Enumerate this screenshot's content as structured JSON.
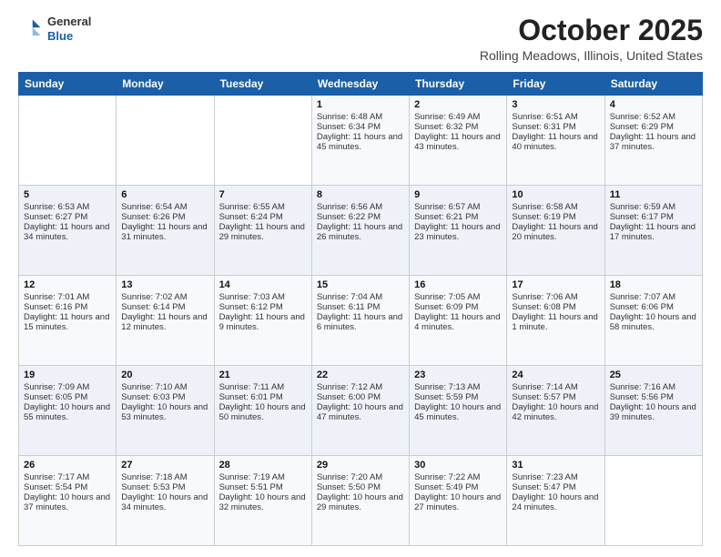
{
  "header": {
    "logo_general": "General",
    "logo_blue": "Blue",
    "month_title": "October 2025",
    "location": "Rolling Meadows, Illinois, United States"
  },
  "days_of_week": [
    "Sunday",
    "Monday",
    "Tuesday",
    "Wednesday",
    "Thursday",
    "Friday",
    "Saturday"
  ],
  "weeks": [
    [
      {
        "day": "",
        "sunrise": "",
        "sunset": "",
        "daylight": ""
      },
      {
        "day": "",
        "sunrise": "",
        "sunset": "",
        "daylight": ""
      },
      {
        "day": "",
        "sunrise": "",
        "sunset": "",
        "daylight": ""
      },
      {
        "day": "1",
        "sunrise": "Sunrise: 6:48 AM",
        "sunset": "Sunset: 6:34 PM",
        "daylight": "Daylight: 11 hours and 45 minutes."
      },
      {
        "day": "2",
        "sunrise": "Sunrise: 6:49 AM",
        "sunset": "Sunset: 6:32 PM",
        "daylight": "Daylight: 11 hours and 43 minutes."
      },
      {
        "day": "3",
        "sunrise": "Sunrise: 6:51 AM",
        "sunset": "Sunset: 6:31 PM",
        "daylight": "Daylight: 11 hours and 40 minutes."
      },
      {
        "day": "4",
        "sunrise": "Sunrise: 6:52 AM",
        "sunset": "Sunset: 6:29 PM",
        "daylight": "Daylight: 11 hours and 37 minutes."
      }
    ],
    [
      {
        "day": "5",
        "sunrise": "Sunrise: 6:53 AM",
        "sunset": "Sunset: 6:27 PM",
        "daylight": "Daylight: 11 hours and 34 minutes."
      },
      {
        "day": "6",
        "sunrise": "Sunrise: 6:54 AM",
        "sunset": "Sunset: 6:26 PM",
        "daylight": "Daylight: 11 hours and 31 minutes."
      },
      {
        "day": "7",
        "sunrise": "Sunrise: 6:55 AM",
        "sunset": "Sunset: 6:24 PM",
        "daylight": "Daylight: 11 hours and 29 minutes."
      },
      {
        "day": "8",
        "sunrise": "Sunrise: 6:56 AM",
        "sunset": "Sunset: 6:22 PM",
        "daylight": "Daylight: 11 hours and 26 minutes."
      },
      {
        "day": "9",
        "sunrise": "Sunrise: 6:57 AM",
        "sunset": "Sunset: 6:21 PM",
        "daylight": "Daylight: 11 hours and 23 minutes."
      },
      {
        "day": "10",
        "sunrise": "Sunrise: 6:58 AM",
        "sunset": "Sunset: 6:19 PM",
        "daylight": "Daylight: 11 hours and 20 minutes."
      },
      {
        "day": "11",
        "sunrise": "Sunrise: 6:59 AM",
        "sunset": "Sunset: 6:17 PM",
        "daylight": "Daylight: 11 hours and 17 minutes."
      }
    ],
    [
      {
        "day": "12",
        "sunrise": "Sunrise: 7:01 AM",
        "sunset": "Sunset: 6:16 PM",
        "daylight": "Daylight: 11 hours and 15 minutes."
      },
      {
        "day": "13",
        "sunrise": "Sunrise: 7:02 AM",
        "sunset": "Sunset: 6:14 PM",
        "daylight": "Daylight: 11 hours and 12 minutes."
      },
      {
        "day": "14",
        "sunrise": "Sunrise: 7:03 AM",
        "sunset": "Sunset: 6:12 PM",
        "daylight": "Daylight: 11 hours and 9 minutes."
      },
      {
        "day": "15",
        "sunrise": "Sunrise: 7:04 AM",
        "sunset": "Sunset: 6:11 PM",
        "daylight": "Daylight: 11 hours and 6 minutes."
      },
      {
        "day": "16",
        "sunrise": "Sunrise: 7:05 AM",
        "sunset": "Sunset: 6:09 PM",
        "daylight": "Daylight: 11 hours and 4 minutes."
      },
      {
        "day": "17",
        "sunrise": "Sunrise: 7:06 AM",
        "sunset": "Sunset: 6:08 PM",
        "daylight": "Daylight: 11 hours and 1 minute."
      },
      {
        "day": "18",
        "sunrise": "Sunrise: 7:07 AM",
        "sunset": "Sunset: 6:06 PM",
        "daylight": "Daylight: 10 hours and 58 minutes."
      }
    ],
    [
      {
        "day": "19",
        "sunrise": "Sunrise: 7:09 AM",
        "sunset": "Sunset: 6:05 PM",
        "daylight": "Daylight: 10 hours and 55 minutes."
      },
      {
        "day": "20",
        "sunrise": "Sunrise: 7:10 AM",
        "sunset": "Sunset: 6:03 PM",
        "daylight": "Daylight: 10 hours and 53 minutes."
      },
      {
        "day": "21",
        "sunrise": "Sunrise: 7:11 AM",
        "sunset": "Sunset: 6:01 PM",
        "daylight": "Daylight: 10 hours and 50 minutes."
      },
      {
        "day": "22",
        "sunrise": "Sunrise: 7:12 AM",
        "sunset": "Sunset: 6:00 PM",
        "daylight": "Daylight: 10 hours and 47 minutes."
      },
      {
        "day": "23",
        "sunrise": "Sunrise: 7:13 AM",
        "sunset": "Sunset: 5:59 PM",
        "daylight": "Daylight: 10 hours and 45 minutes."
      },
      {
        "day": "24",
        "sunrise": "Sunrise: 7:14 AM",
        "sunset": "Sunset: 5:57 PM",
        "daylight": "Daylight: 10 hours and 42 minutes."
      },
      {
        "day": "25",
        "sunrise": "Sunrise: 7:16 AM",
        "sunset": "Sunset: 5:56 PM",
        "daylight": "Daylight: 10 hours and 39 minutes."
      }
    ],
    [
      {
        "day": "26",
        "sunrise": "Sunrise: 7:17 AM",
        "sunset": "Sunset: 5:54 PM",
        "daylight": "Daylight: 10 hours and 37 minutes."
      },
      {
        "day": "27",
        "sunrise": "Sunrise: 7:18 AM",
        "sunset": "Sunset: 5:53 PM",
        "daylight": "Daylight: 10 hours and 34 minutes."
      },
      {
        "day": "28",
        "sunrise": "Sunrise: 7:19 AM",
        "sunset": "Sunset: 5:51 PM",
        "daylight": "Daylight: 10 hours and 32 minutes."
      },
      {
        "day": "29",
        "sunrise": "Sunrise: 7:20 AM",
        "sunset": "Sunset: 5:50 PM",
        "daylight": "Daylight: 10 hours and 29 minutes."
      },
      {
        "day": "30",
        "sunrise": "Sunrise: 7:22 AM",
        "sunset": "Sunset: 5:49 PM",
        "daylight": "Daylight: 10 hours and 27 minutes."
      },
      {
        "day": "31",
        "sunrise": "Sunrise: 7:23 AM",
        "sunset": "Sunset: 5:47 PM",
        "daylight": "Daylight: 10 hours and 24 minutes."
      },
      {
        "day": "",
        "sunrise": "",
        "sunset": "",
        "daylight": ""
      }
    ]
  ]
}
